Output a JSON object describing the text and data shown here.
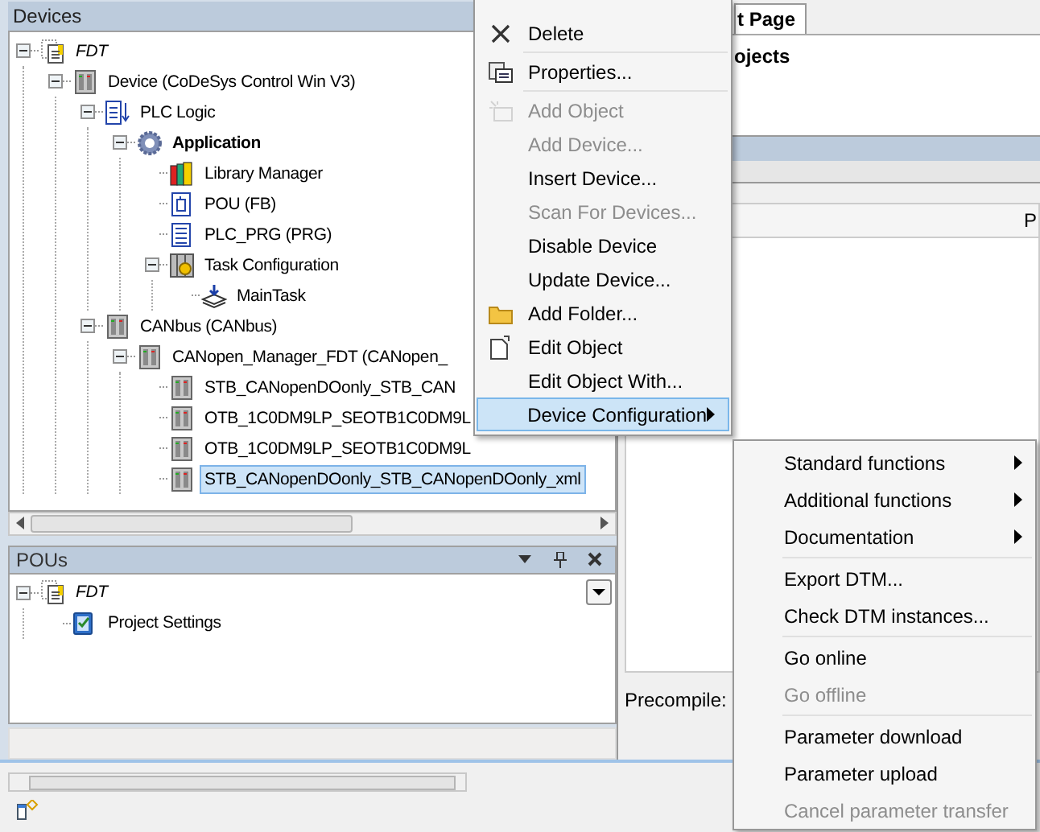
{
  "devices_panel": {
    "title": "Devices",
    "tree": [
      {
        "label": "FDT",
        "kind": "project",
        "expanded": true,
        "selected": false,
        "children": [
          {
            "label": "Device (CoDeSys Control Win V3)",
            "kind": "device",
            "expanded": true,
            "selected": false,
            "children": [
              {
                "label": "PLC Logic",
                "kind": "plc-logic",
                "expanded": true,
                "selected": false,
                "children": [
                  {
                    "label": "Application",
                    "kind": "application",
                    "expanded": true,
                    "selected": false,
                    "children": [
                      {
                        "label": "Library Manager",
                        "kind": "library",
                        "selected": false
                      },
                      {
                        "label": "POU (FB)",
                        "kind": "pou",
                        "selected": false
                      },
                      {
                        "label": "PLC_PRG (PRG)",
                        "kind": "program",
                        "selected": false
                      },
                      {
                        "label": "Task Configuration",
                        "kind": "task-config",
                        "expanded": true,
                        "selected": false,
                        "children": [
                          {
                            "label": "MainTask",
                            "kind": "task",
                            "selected": false
                          }
                        ]
                      }
                    ]
                  }
                ]
              },
              {
                "label": "CANbus (CANbus)",
                "kind": "device",
                "expanded": true,
                "selected": false,
                "children": [
                  {
                    "label": "CANopen_Manager_FDT (CANopen_",
                    "kind": "device",
                    "expanded": true,
                    "selected": false,
                    "children": [
                      {
                        "label": "STB_CANopenDOonly_STB_CAN",
                        "kind": "device",
                        "selected": false
                      },
                      {
                        "label": "OTB_1C0DM9LP_SEOTB1C0DM9L",
                        "kind": "device",
                        "selected": false
                      },
                      {
                        "label": "OTB_1C0DM9LP_SEOTB1C0DM9L",
                        "kind": "device",
                        "selected": false
                      },
                      {
                        "label": "STB_CANopenDOonly_STB_CANopenDOonly_xml",
                        "kind": "device",
                        "selected": true
                      }
                    ]
                  }
                ]
              }
            ]
          }
        ]
      }
    ]
  },
  "pous_panel": {
    "title": "POUs",
    "tree": [
      {
        "label": "FDT",
        "kind": "project",
        "expanded": true,
        "selected": false,
        "children": [
          {
            "label": "Project Settings",
            "kind": "settings",
            "selected": false
          }
        ]
      }
    ]
  },
  "document": {
    "tab": {
      "label": "t Page",
      "selected": true
    },
    "group_title": "ojects",
    "column_header": "P",
    "field_label": "Precompile:"
  },
  "context_menu": {
    "items": [
      {
        "kind": "item",
        "label": "Delete",
        "disabled": false,
        "selected": false,
        "submenu": false
      },
      {
        "kind": "separator"
      },
      {
        "kind": "item",
        "label": "Properties...",
        "disabled": false,
        "selected": false,
        "submenu": false
      },
      {
        "kind": "separator"
      },
      {
        "kind": "item",
        "label": "Add Object",
        "disabled": true,
        "selected": false,
        "submenu": false
      },
      {
        "kind": "item",
        "label": "Add Device...",
        "disabled": true,
        "selected": false,
        "submenu": false
      },
      {
        "kind": "item",
        "label": "Insert Device...",
        "disabled": false,
        "selected": false,
        "submenu": false
      },
      {
        "kind": "item",
        "label": "Scan For Devices...",
        "disabled": true,
        "selected": false,
        "submenu": false
      },
      {
        "kind": "item",
        "label": "Disable Device",
        "disabled": false,
        "selected": false,
        "submenu": false
      },
      {
        "kind": "item",
        "label": "Update Device...",
        "disabled": false,
        "selected": false,
        "submenu": false
      },
      {
        "kind": "item",
        "label": "Add Folder...",
        "disabled": false,
        "selected": false,
        "submenu": false
      },
      {
        "kind": "item",
        "label": "Edit Object",
        "disabled": false,
        "selected": false,
        "submenu": false
      },
      {
        "kind": "item",
        "label": "Edit Object With...",
        "disabled": false,
        "selected": false,
        "submenu": false
      },
      {
        "kind": "item",
        "label": "Device Configuration",
        "disabled": false,
        "selected": true,
        "submenu": true
      }
    ]
  },
  "submenu": {
    "items": [
      {
        "kind": "item",
        "label": "Standard functions",
        "disabled": false,
        "submenu": true
      },
      {
        "kind": "item",
        "label": "Additional functions",
        "disabled": false,
        "submenu": true
      },
      {
        "kind": "item",
        "label": "Documentation",
        "disabled": false,
        "submenu": true
      },
      {
        "kind": "separator"
      },
      {
        "kind": "item",
        "label": "Export DTM...",
        "disabled": false,
        "submenu": false
      },
      {
        "kind": "item",
        "label": "Check DTM instances...",
        "disabled": false,
        "submenu": false
      },
      {
        "kind": "separator"
      },
      {
        "kind": "item",
        "label": "Go online",
        "disabled": false,
        "submenu": false
      },
      {
        "kind": "item",
        "label": "Go offline",
        "disabled": true,
        "submenu": false
      },
      {
        "kind": "separator"
      },
      {
        "kind": "item",
        "label": "Parameter download",
        "disabled": false,
        "submenu": false
      },
      {
        "kind": "item",
        "label": "Parameter upload",
        "disabled": false,
        "submenu": false
      },
      {
        "kind": "item",
        "label": "Cancel parameter transfer",
        "disabled": true,
        "submenu": false
      }
    ]
  }
}
